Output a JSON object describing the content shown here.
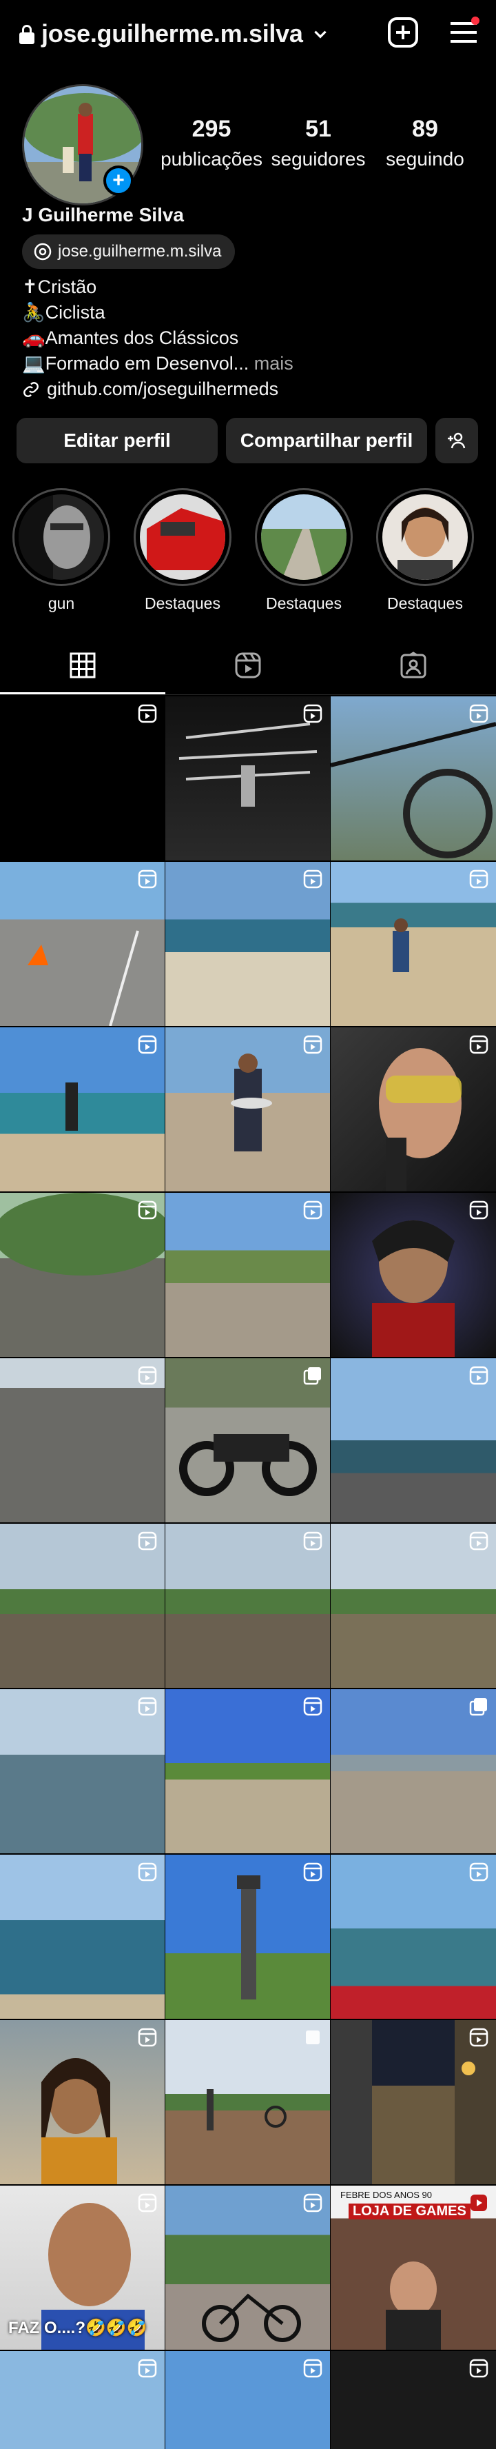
{
  "header": {
    "username": "jose.guilherme.m.silva",
    "icons": [
      "lock-icon",
      "chevron-down-icon",
      "add-post-icon",
      "menu-icon"
    ]
  },
  "profile": {
    "stats": [
      {
        "value": "295",
        "label": "publicações"
      },
      {
        "value": "51",
        "label": "seguidores"
      },
      {
        "value": "89",
        "label": "seguindo"
      }
    ],
    "name": "J Guilherme Silva",
    "threads_handle": "jose.guilherme.m.silva",
    "bio": {
      "line1": "✝Cristão",
      "line2": "🚴Ciclista",
      "line3": "🚗Amantes dos Clássicos",
      "line4_text": "💻Formado em Desenvol...",
      "line4_more": " mais",
      "link": "github.com/joseguilhermeds"
    }
  },
  "actions": {
    "edit_label": "Editar perfil",
    "share_label": "Compartilhar perfil"
  },
  "highlights": [
    {
      "label": "gun"
    },
    {
      "label": "Destaques"
    },
    {
      "label": "Destaques"
    },
    {
      "label": "Destaques"
    }
  ],
  "tabs": [
    "grid",
    "reels",
    "tagged"
  ],
  "grid_texts": {
    "faz_text": "FAZ O....?🤣🤣🤣",
    "games_line1": "FEBRE DOS ANOS 90",
    "games_line2": "LOJA DE GAMES"
  }
}
